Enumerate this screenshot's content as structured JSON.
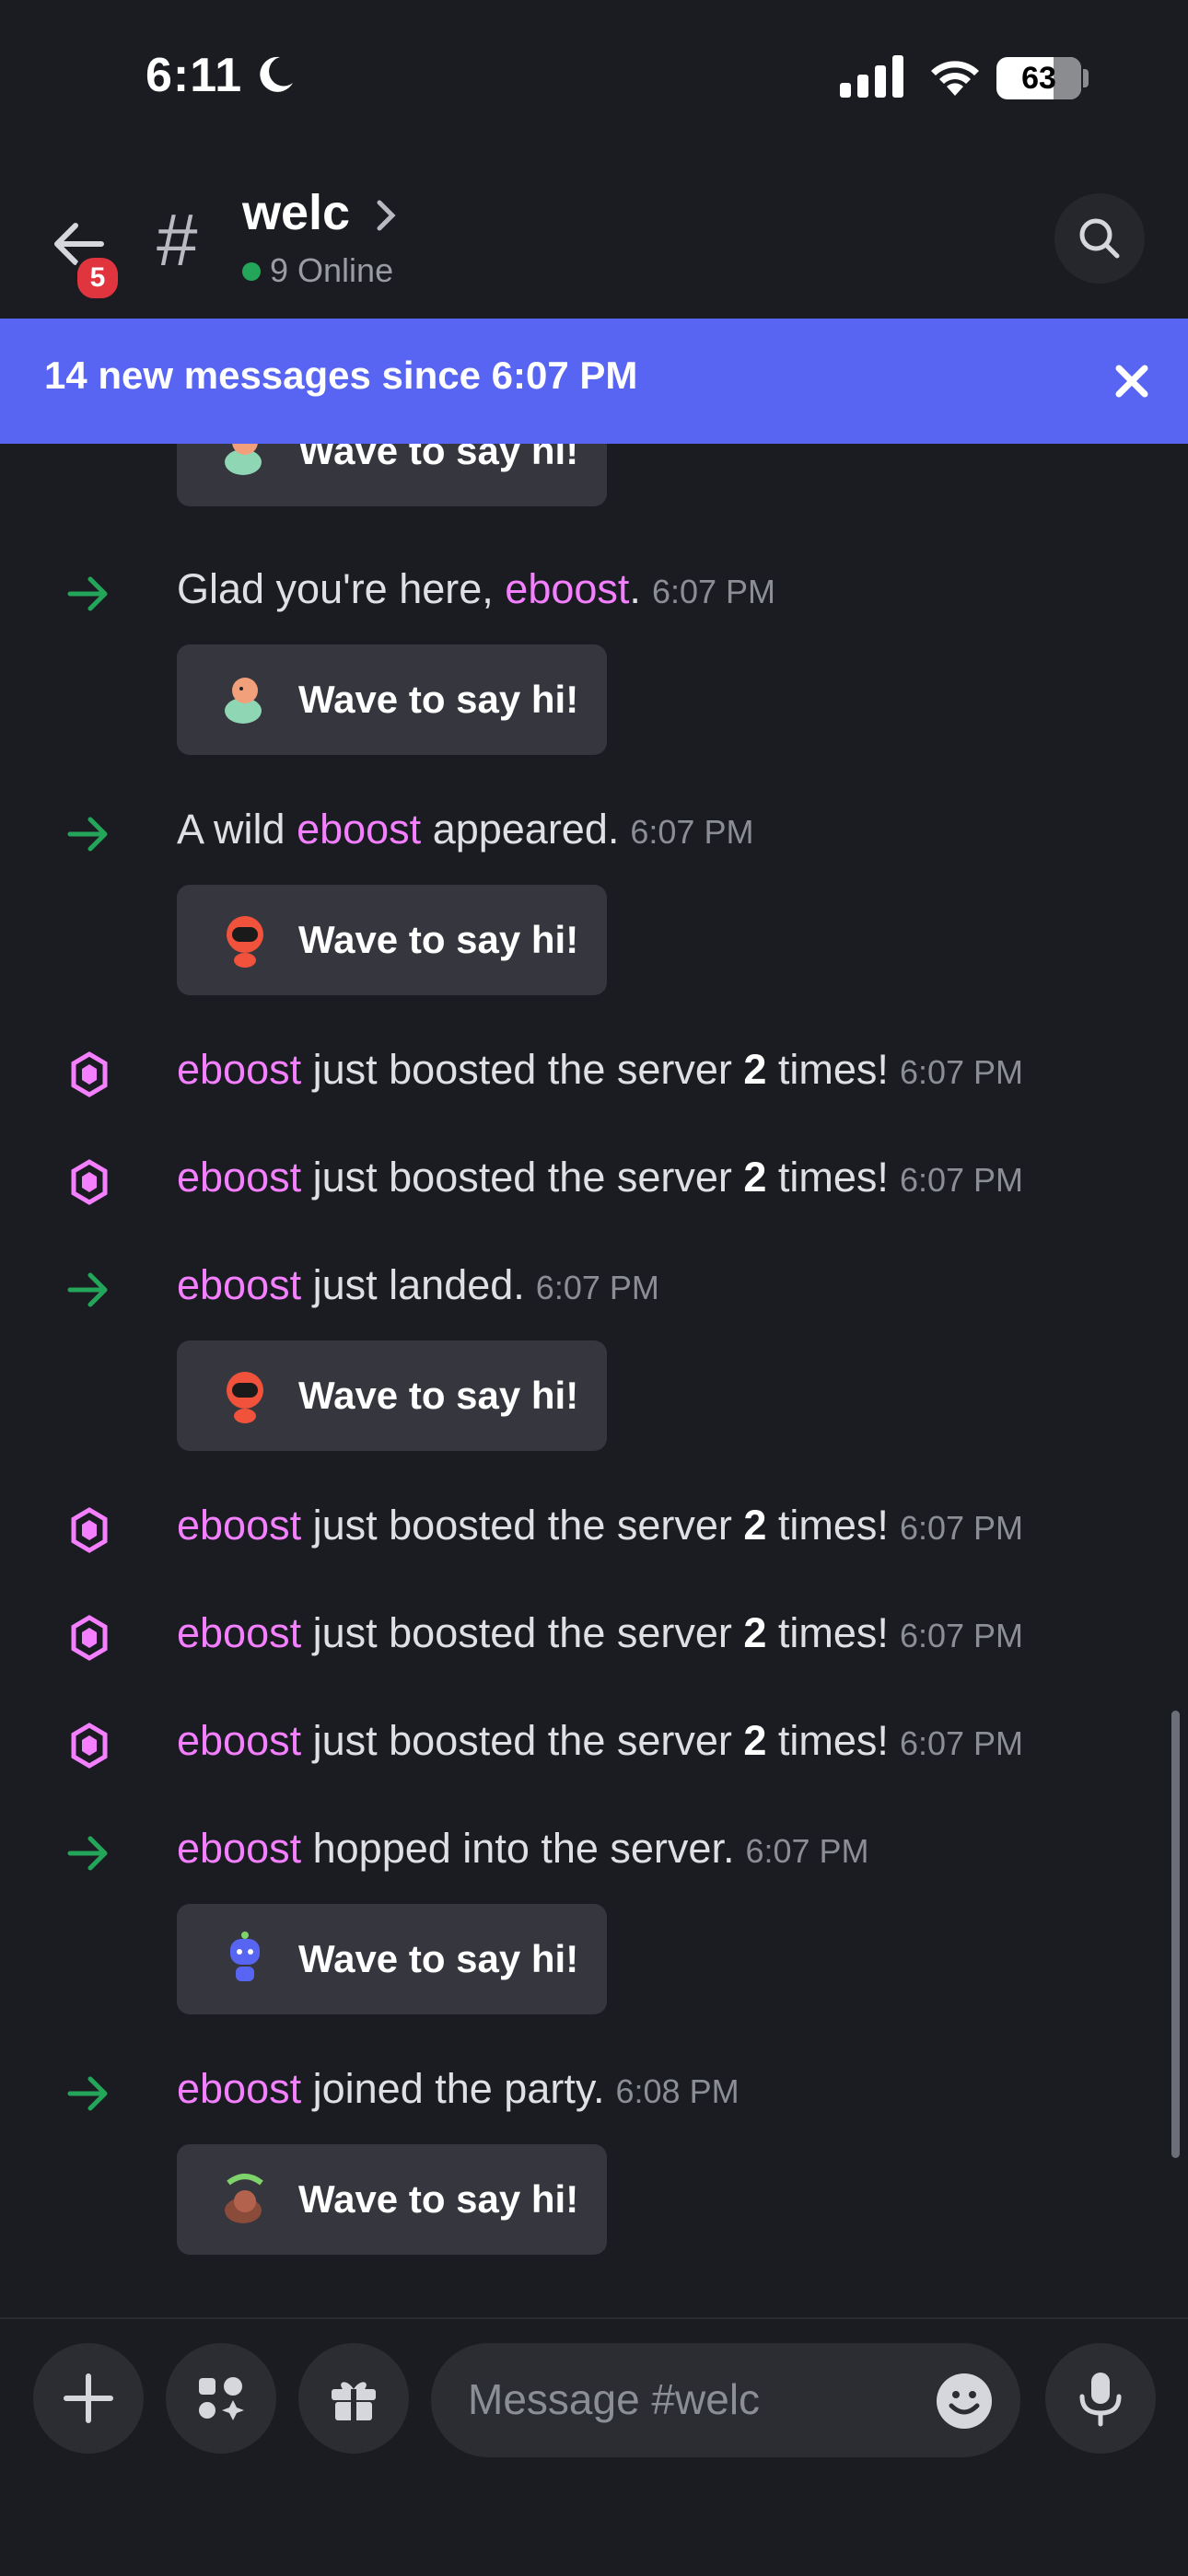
{
  "status_bar": {
    "time": "6:11",
    "battery": "63"
  },
  "header": {
    "back_badge": "5",
    "hash": "#",
    "channel_name": "welc",
    "online": "9 Online"
  },
  "banner": {
    "text": "14 new messages since 6:07 PM"
  },
  "wave_label": "Wave to say hi!",
  "messages": [
    {
      "type": "wave-partial",
      "wave": "Wave to say hi!"
    },
    {
      "type": "join",
      "before": "Glad you're here, ",
      "user": "eboost",
      "after": ".",
      "time": "6:07 PM",
      "wave": "Wave to say hi!"
    },
    {
      "type": "join",
      "before": "A wild ",
      "user": "eboost",
      "after": " appeared.",
      "time": "6:07 PM",
      "wave": "Wave to say hi!"
    },
    {
      "type": "boost",
      "user": "eboost",
      "text1": " just boosted the server ",
      "count": "2",
      "text2": " times!",
      "time": "6:07 PM"
    },
    {
      "type": "boost",
      "user": "eboost",
      "text1": " just boosted the server ",
      "count": "2",
      "text2": " times!",
      "time": "6:07 PM"
    },
    {
      "type": "join",
      "before": "",
      "user": "eboost",
      "after": " just landed.",
      "time": "6:07 PM",
      "wave": "Wave to say hi!"
    },
    {
      "type": "boost",
      "user": "eboost",
      "text1": " just boosted the server ",
      "count": "2",
      "text2": " times!",
      "time": "6:07 PM"
    },
    {
      "type": "boost",
      "user": "eboost",
      "text1": " just boosted the server ",
      "count": "2",
      "text2": " times!",
      "time": "6:07 PM"
    },
    {
      "type": "boost",
      "user": "eboost",
      "text1": " just boosted the server ",
      "count": "2",
      "text2": " times!",
      "time": "6:07 PM"
    },
    {
      "type": "join",
      "before": "",
      "user": "eboost",
      "after": " hopped into the server.",
      "time": "6:07 PM",
      "wave": "Wave to say hi!"
    },
    {
      "type": "join",
      "before": "",
      "user": "eboost",
      "after": " joined the party.",
      "time": "6:08 PM",
      "wave": "Wave to say hi!"
    }
  ],
  "composer": {
    "placeholder": "Message #welc"
  },
  "icons": {
    "back": "arrow-left-icon",
    "search": "search-icon",
    "close": "close-icon",
    "join": "arrow-right-icon",
    "boost": "nitro-boost-icon",
    "plus": "plus-icon",
    "apps": "apps-icon",
    "gift": "gift-icon",
    "emoji": "emoji-icon",
    "mic": "microphone-icon"
  },
  "colors": {
    "accent": "#5865f2",
    "username": "#f47fff",
    "join_arrow": "#23a55a",
    "badge": "#e0353e"
  }
}
